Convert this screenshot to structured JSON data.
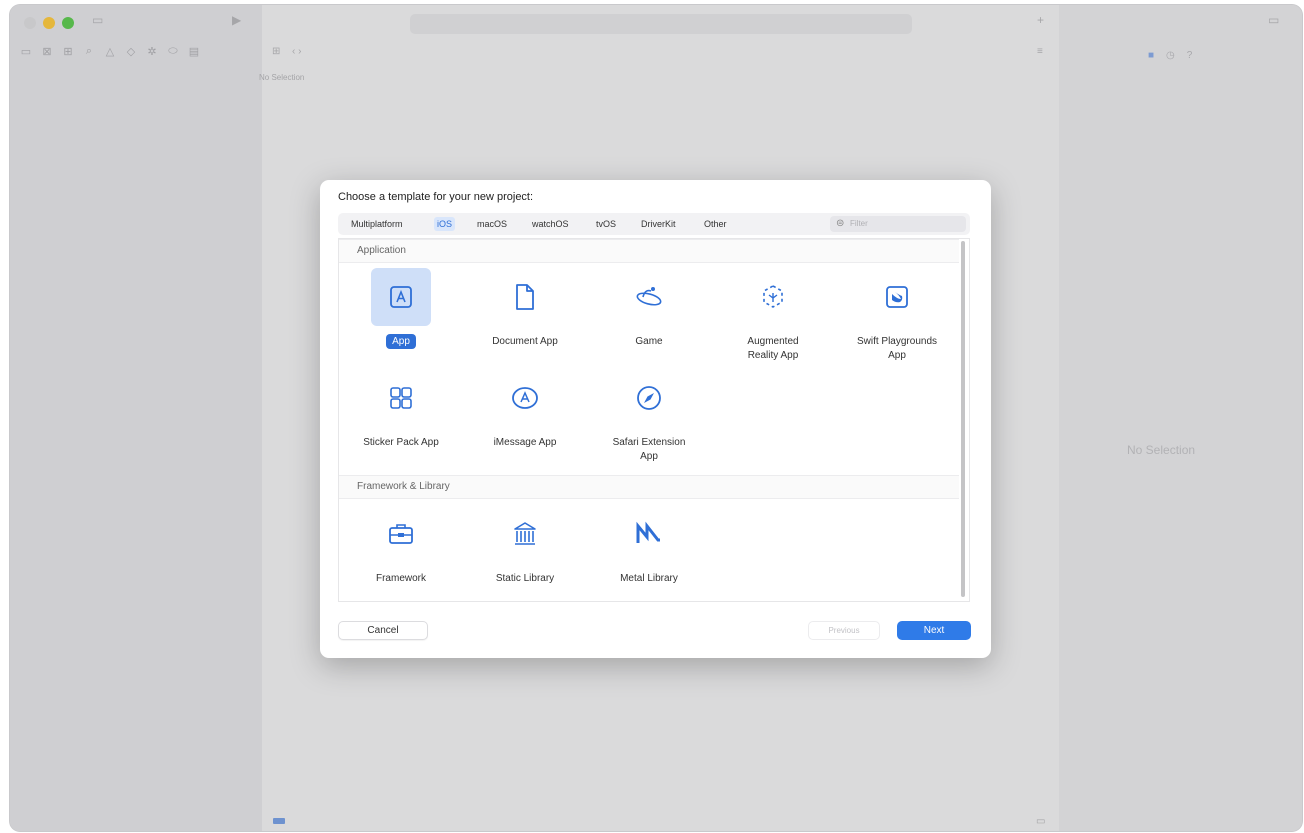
{
  "window": {
    "editor_no_selection": "No Selection",
    "inspector_no_selection": "No Selection"
  },
  "dialog": {
    "title": "Choose a template for your new project:",
    "tabs": [
      {
        "label": "Multiplatform",
        "selected": false
      },
      {
        "label": "iOS",
        "selected": true
      },
      {
        "label": "macOS",
        "selected": false
      },
      {
        "label": "watchOS",
        "selected": false
      },
      {
        "label": "tvOS",
        "selected": false
      },
      {
        "label": "DriverKit",
        "selected": false
      },
      {
        "label": "Other",
        "selected": false
      }
    ],
    "filter_placeholder": "Filter",
    "sections": [
      {
        "title": "Application",
        "items": [
          {
            "label": "App",
            "icon": "app-icon",
            "selected": true
          },
          {
            "label": "Document App",
            "icon": "document-icon"
          },
          {
            "label": "Game",
            "icon": "game-icon"
          },
          {
            "label": "Augmented Reality App",
            "icon": "ar-icon"
          },
          {
            "label": "Swift Playgrounds App",
            "icon": "swift-playgrounds-icon"
          },
          {
            "label": "Sticker Pack App",
            "icon": "sticker-pack-icon"
          },
          {
            "label": "iMessage App",
            "icon": "imessage-icon"
          },
          {
            "label": "Safari Extension App",
            "icon": "safari-icon"
          }
        ]
      },
      {
        "title": "Framework & Library",
        "items": [
          {
            "label": "Framework",
            "icon": "framework-icon"
          },
          {
            "label": "Static Library",
            "icon": "static-library-icon"
          },
          {
            "label": "Metal Library",
            "icon": "metal-library-icon"
          }
        ]
      }
    ],
    "buttons": {
      "cancel": "Cancel",
      "previous": "Previous",
      "next": "Next"
    }
  },
  "colors": {
    "accent": "#2f7be8",
    "icon_blue": "#2f6fd6"
  }
}
